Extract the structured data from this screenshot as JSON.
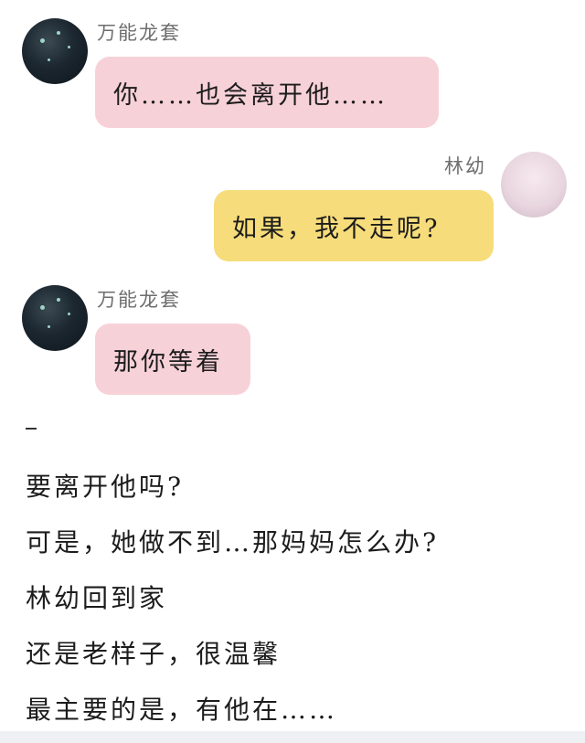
{
  "messages": [
    {
      "sender": "万能龙套",
      "text": "你……也会离开他……"
    },
    {
      "sender": "林幼",
      "text": "如果，我不走呢?"
    },
    {
      "sender": "万能龙套",
      "text": "那你等着"
    }
  ],
  "separator": "–",
  "paragraphs": [
    "要离开他吗?",
    "可是，她做不到…那妈妈怎么办?",
    "林幼回到家",
    "还是老样子，很温馨",
    "最主要的是，有他在……"
  ],
  "colors": {
    "left_bubble": "#f7d1d8",
    "right_bubble": "#f6dc7a",
    "name_text": "#6e6e6e"
  }
}
